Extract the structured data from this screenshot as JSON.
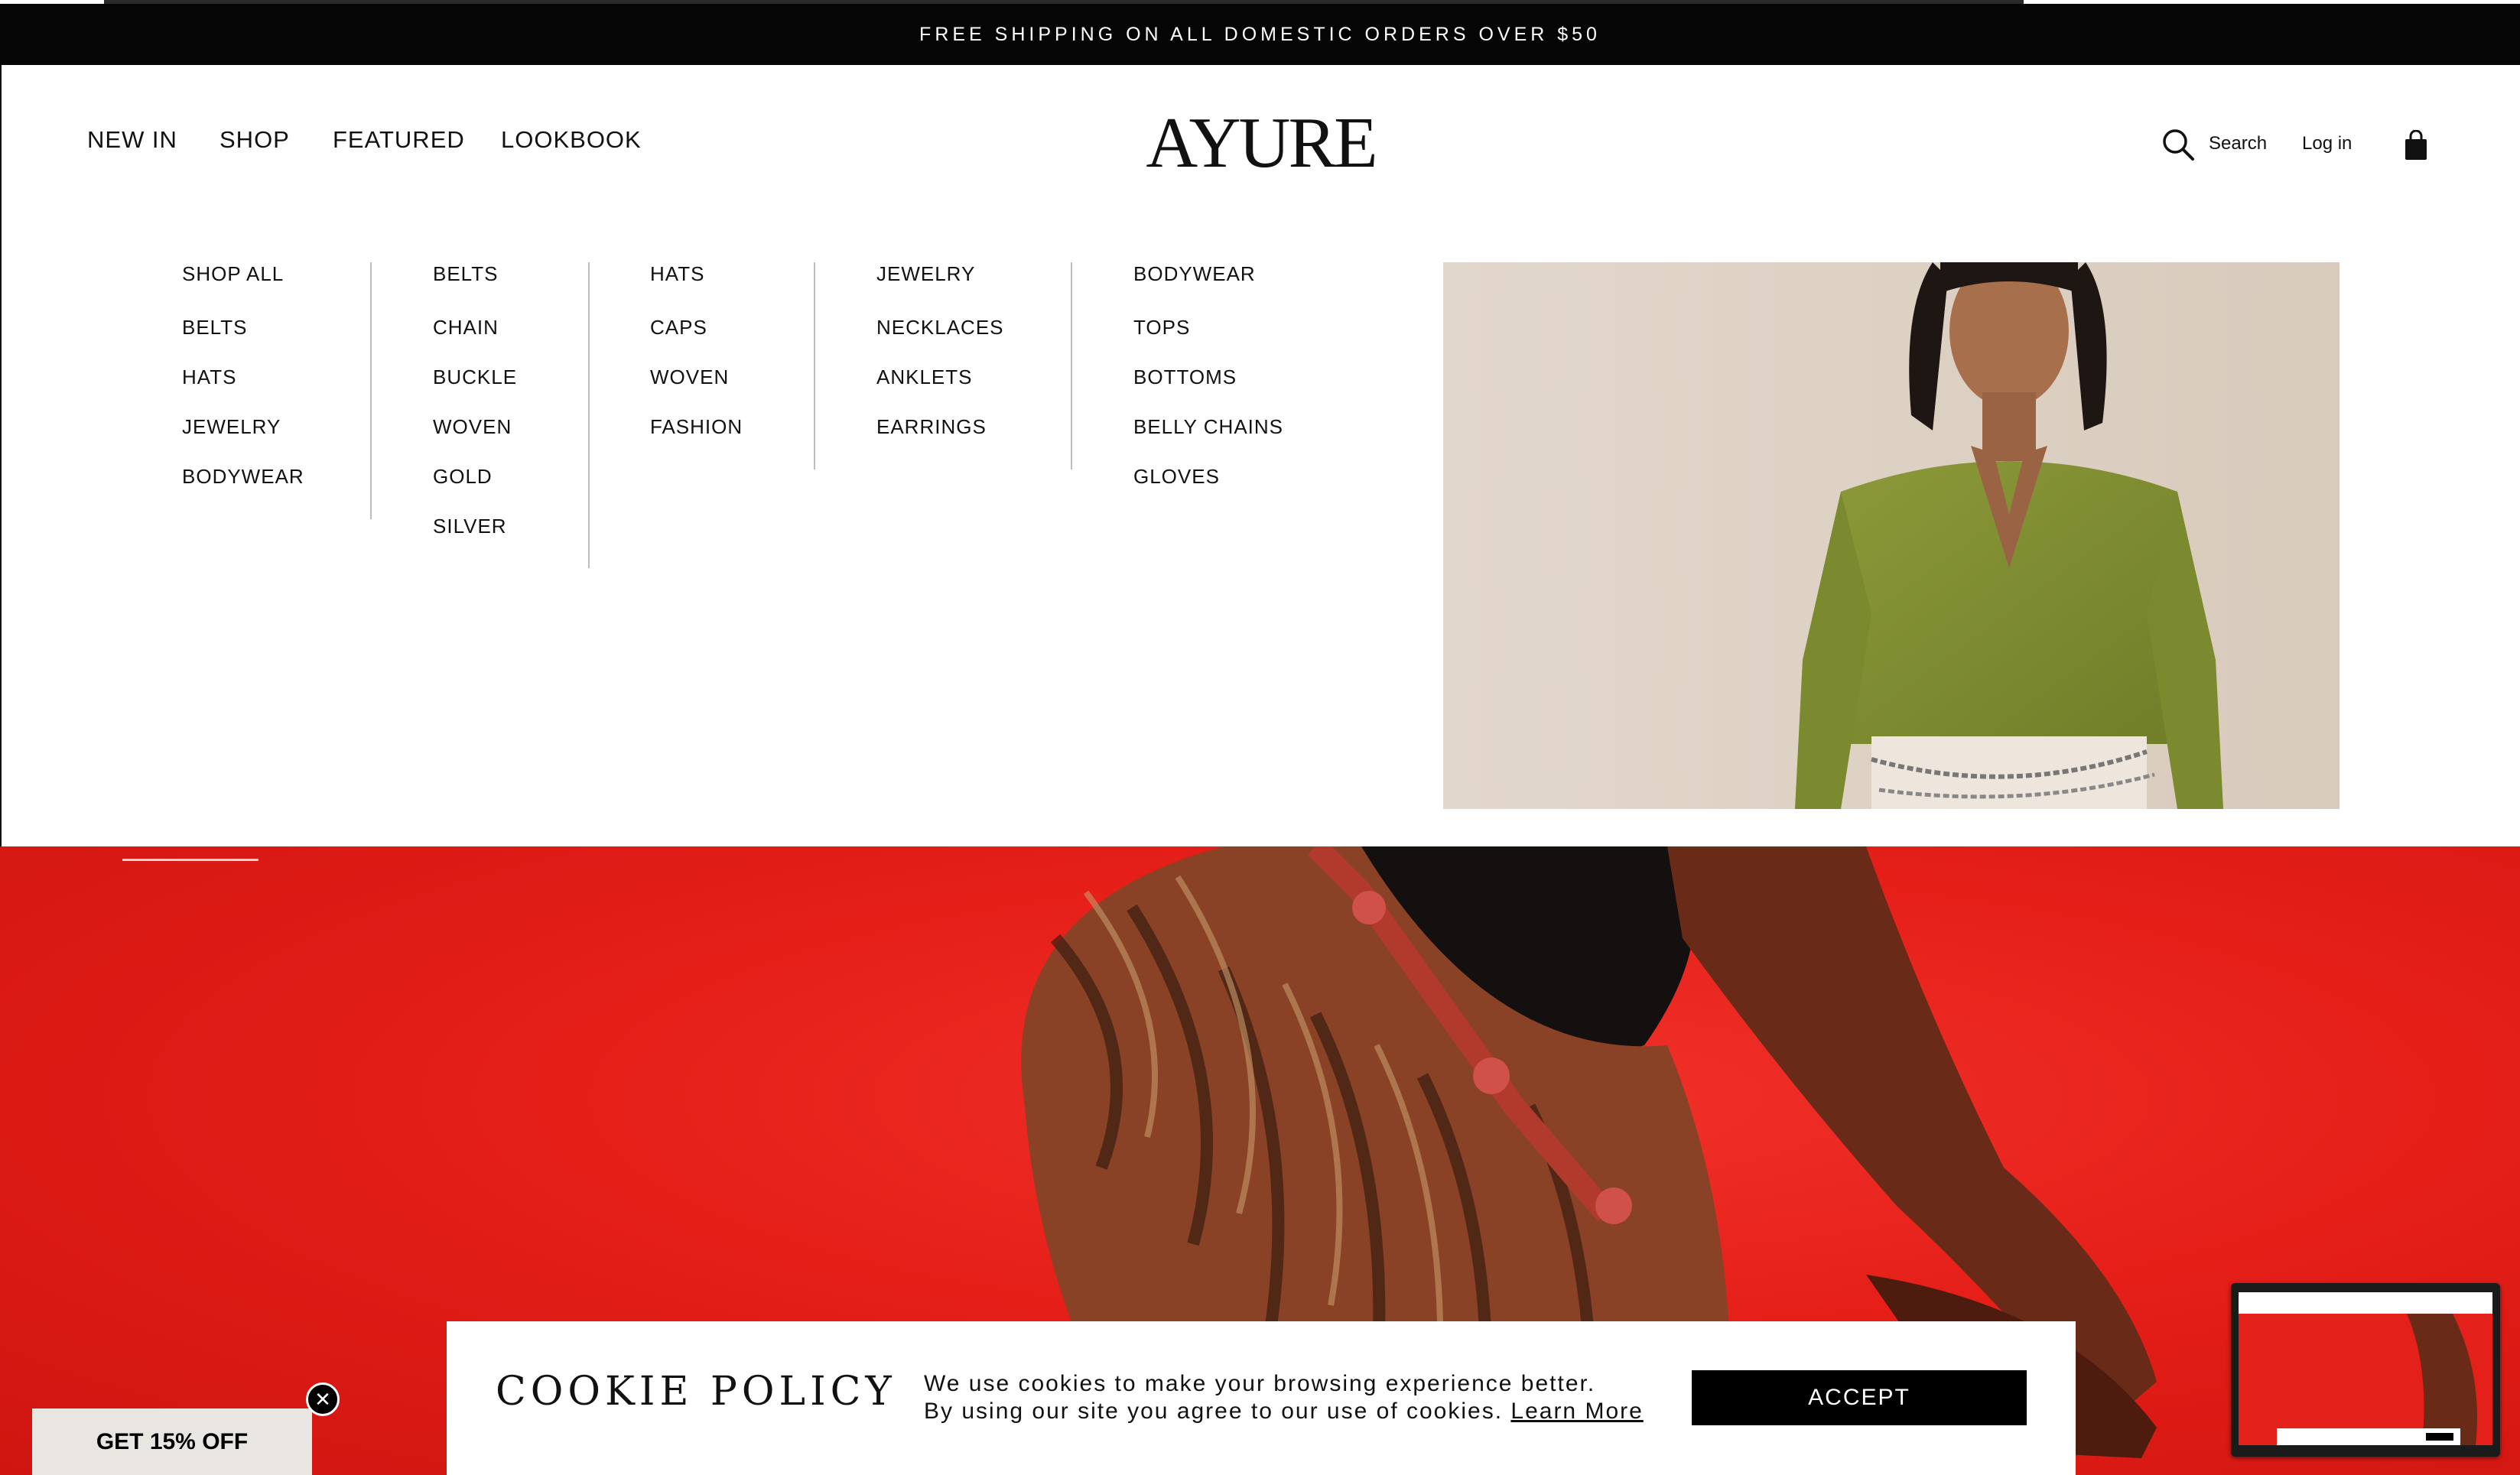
{
  "announcement": {
    "text": "FREE SHIPPING ON ALL DOMESTIC ORDERS OVER $50"
  },
  "nav": {
    "items": [
      {
        "label": "NEW IN"
      },
      {
        "label": "SHOP"
      },
      {
        "label": "FEATURED"
      },
      {
        "label": "LOOKBOOK"
      }
    ]
  },
  "brand": {
    "logo": "AYURE"
  },
  "header_actions": {
    "search_label": "Search",
    "login_label": "Log in",
    "search_icon": "search-icon",
    "cart_icon": "shopping-bag-icon"
  },
  "mega_menu": {
    "columns": [
      {
        "heading": "SHOP ALL",
        "items": [
          "BELTS",
          "HATS",
          "JEWELRY",
          "BODYWEAR"
        ]
      },
      {
        "heading": "BELTS",
        "items": [
          "CHAIN",
          "BUCKLE",
          "WOVEN",
          "GOLD",
          "SILVER"
        ]
      },
      {
        "heading": "HATS",
        "items": [
          "CAPS",
          "WOVEN",
          "FASHION"
        ]
      },
      {
        "heading": "JEWELRY",
        "items": [
          "NECKLACES",
          "ANKLETS",
          "EARRINGS"
        ]
      },
      {
        "heading": "BODYWEAR",
        "items": [
          "TOPS",
          "BOTTOMS",
          "BELLY CHAINS",
          "GLOVES"
        ]
      }
    ]
  },
  "cookie": {
    "title": "COOKIE POLICY",
    "line1": "We use cookies to make your browsing experience better.",
    "line2": "By using our site you agree to our use of cookies.",
    "learn_more": "Learn More",
    "accept": "ACCEPT"
  },
  "discount": {
    "label": "GET 15% OFF",
    "close_icon": "close-icon"
  },
  "colors": {
    "announcement_bg": "#050505",
    "hero_red": "#e51e18",
    "promo_bg": "#ddd1c3",
    "button_bg": "#000000"
  }
}
